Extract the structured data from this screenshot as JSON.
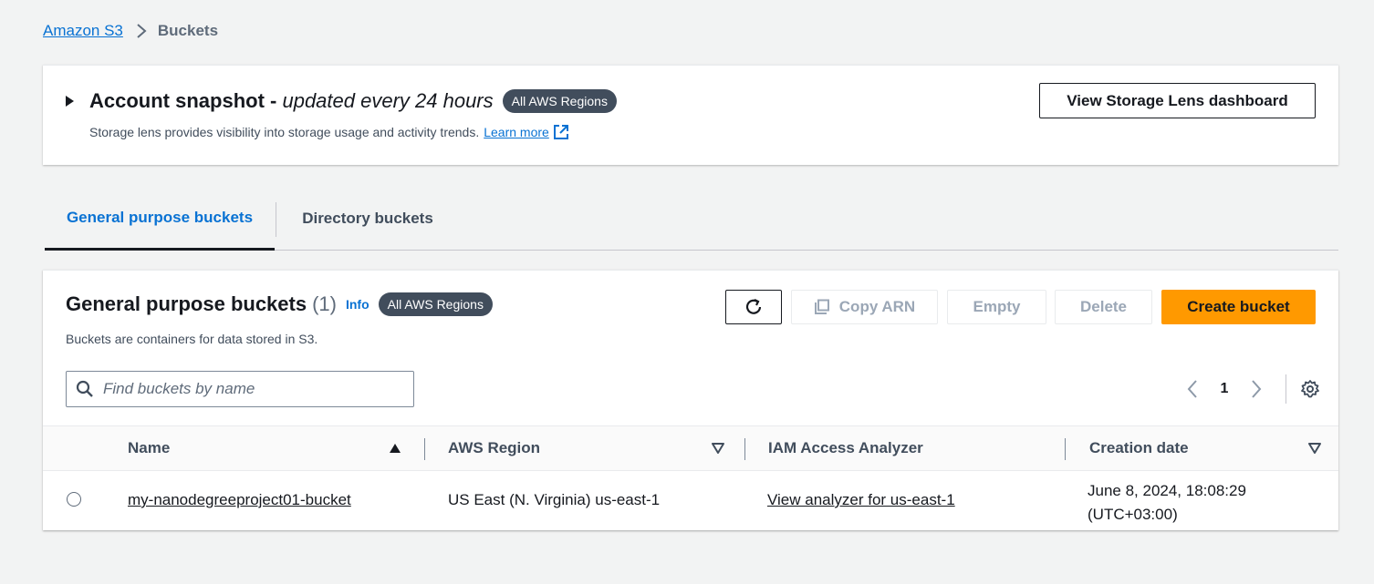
{
  "breadcrumb": {
    "root": "Amazon S3",
    "current": "Buckets"
  },
  "snapshot": {
    "title": "Account snapshot -",
    "title_italic": "updated every 24 hours",
    "badge": "All AWS Regions",
    "description": "Storage lens provides visibility into storage usage and activity trends.",
    "learn_more": "Learn more",
    "dashboard_button": "View Storage Lens dashboard"
  },
  "tabs": [
    {
      "label": "General purpose buckets",
      "active": true
    },
    {
      "label": "Directory buckets",
      "active": false
    }
  ],
  "panel": {
    "title": "General purpose buckets",
    "count": "(1)",
    "info": "Info",
    "badge": "All AWS Regions",
    "description": "Buckets are containers for data stored in S3.",
    "buttons": {
      "copy_arn": "Copy ARN",
      "empty": "Empty",
      "delete": "Delete",
      "create": "Create bucket"
    },
    "search": {
      "placeholder": "Find buckets by name",
      "value": ""
    },
    "pagination": {
      "current_page": "1"
    },
    "columns": {
      "name": "Name",
      "region": "AWS Region",
      "iam": "IAM Access Analyzer",
      "date": "Creation date"
    },
    "rows": [
      {
        "name": "my-nanodegreeproject01-bucket",
        "region": "US East (N. Virginia) us-east-1",
        "iam": "View analyzer for us-east-1",
        "date_line1": "June 8, 2024, 18:08:29",
        "date_line2": "(UTC+03:00)"
      }
    ]
  },
  "colors": {
    "link": "#0972d3",
    "primary": "#ff9900",
    "badge": "#414d5c",
    "background": "#f2f3f3"
  }
}
